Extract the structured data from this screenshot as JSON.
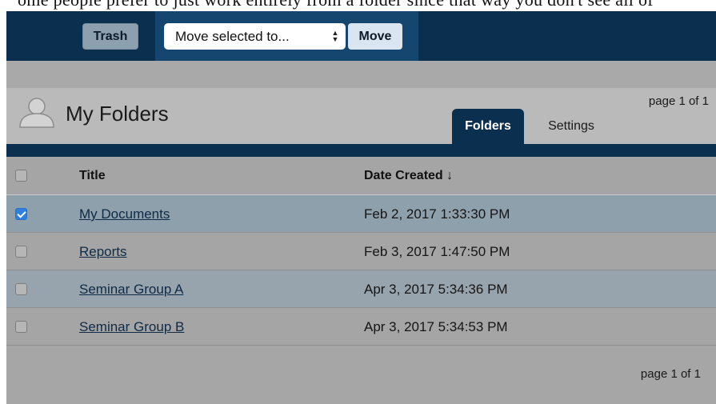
{
  "top_fragment": "ome people prefer to just work entirely from a folder since that way you don't see all of",
  "toolbar": {
    "trash_label": "Trash",
    "move_select_value": "Move selected to...",
    "move_label": "Move"
  },
  "header": {
    "title": "My Folders",
    "pager": "page 1 of 1",
    "tabs": [
      {
        "label": "Folders",
        "active": true
      },
      {
        "label": "Settings",
        "active": false
      }
    ]
  },
  "table": {
    "columns": {
      "title": "Title",
      "date": "Date Created ↓"
    },
    "rows": [
      {
        "title": "My Documents",
        "date": "Feb 2, 2017 1:33:30 PM",
        "checked": true
      },
      {
        "title": "Reports",
        "date": "Feb 3, 2017 1:47:50 PM",
        "checked": false
      },
      {
        "title": "Seminar Group A",
        "date": "Apr 3, 2017 5:34:36 PM",
        "checked": false
      },
      {
        "title": "Seminar Group B",
        "date": "Apr 3, 2017 5:34:53 PM",
        "checked": false
      }
    ]
  },
  "footer": {
    "pager": "page 1 of 1"
  },
  "colors": {
    "navy": "#0b2f4e",
    "toolbar_group": "#14466f",
    "checkbox_checked": "#2f7fe0",
    "selected_row": "#8fa0ad"
  }
}
